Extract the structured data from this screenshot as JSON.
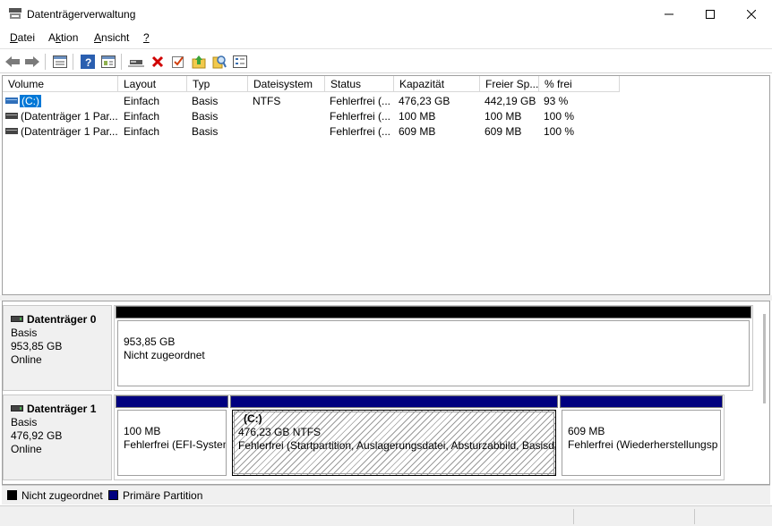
{
  "window": {
    "title": "Datenträgerverwaltung",
    "minimize_glyph": "—",
    "maximize_glyph": "☐",
    "close_glyph": "✕"
  },
  "menu": [
    {
      "label": "Datei",
      "underline": "D",
      "rest": "atei"
    },
    {
      "label": "Aktion",
      "pre": "A",
      "underline": "k",
      "rest": "tion"
    },
    {
      "label": "Ansicht",
      "underline": "A",
      "rest": "nsicht"
    },
    {
      "label": "?",
      "underline": "?",
      "rest": ""
    }
  ],
  "toolbar": {
    "icons": [
      "back-arrow-icon",
      "forward-arrow-icon",
      "properties-list-icon",
      "help-icon",
      "console-pane-icon",
      "connect-disk-icon",
      "delete-icon",
      "checklist-icon",
      "folder-up-icon",
      "search-properties-icon",
      "settings-dialog-icon"
    ]
  },
  "volume_list": {
    "columns": [
      "Volume",
      "Layout",
      "Typ",
      "Dateisystem",
      "Status",
      "Kapazität",
      "Freier Sp...",
      "% frei"
    ],
    "rows": [
      {
        "volume": "(C:)",
        "layout": "Einfach",
        "typ": "Basis",
        "fs": "NTFS",
        "status": "Fehlerfrei (...",
        "kapazitaet": "476,23 GB",
        "frei": "442,19 GB",
        "prozent": "93 %"
      },
      {
        "volume": "(Datenträger 1 Par...",
        "layout": "Einfach",
        "typ": "Basis",
        "fs": "",
        "status": "Fehlerfrei (...",
        "kapazitaet": "100 MB",
        "frei": "100 MB",
        "prozent": "100 %"
      },
      {
        "volume": "(Datenträger 1 Par...",
        "layout": "Einfach",
        "typ": "Basis",
        "fs": "",
        "status": "Fehlerfrei (...",
        "kapazitaet": "609 MB",
        "frei": "609 MB",
        "prozent": "100 %"
      }
    ]
  },
  "disks": [
    {
      "name": "Datenträger 0",
      "type": "Basis",
      "size": "953,85 GB",
      "state": "Online",
      "partitions": [
        {
          "size": "953,85 GB",
          "status": "Nicht zugeordnet",
          "color": "#000000"
        }
      ]
    },
    {
      "name": "Datenträger 1",
      "type": "Basis",
      "size": "476,92 GB",
      "state": "Online",
      "partitions": [
        {
          "size": "100 MB",
          "status": "Fehlerfrei (EFI-System",
          "color": "#00007f"
        },
        {
          "label": "(C:)",
          "size": "476,23 GB NTFS",
          "status": "Fehlerfrei (Startpartition, Auslagerungsdatei, Absturzabbild, Basisda",
          "color": "#00007f"
        },
        {
          "size": "609 MB",
          "status": "Fehlerfrei (Wiederherstellungsp",
          "color": "#00007f"
        }
      ]
    }
  ],
  "legend": [
    {
      "label": "Nicht zugeordnet",
      "color": "#000000"
    },
    {
      "label": "Primäre Partition",
      "color": "#00007f"
    }
  ]
}
